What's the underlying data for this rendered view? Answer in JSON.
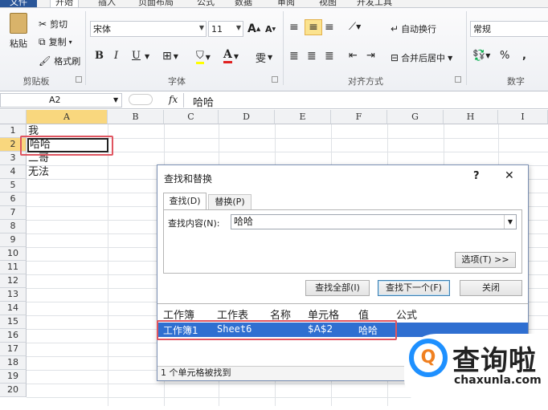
{
  "tabs": {
    "file": "文件",
    "home": "开始",
    "insert": "插入",
    "layout": "页面布局",
    "formulas": "公式",
    "data": "数据",
    "review": "审阅",
    "view": "视图",
    "dev": "开发工具"
  },
  "clipboard": {
    "paste": "粘贴",
    "cut": "剪切",
    "copy": "复制",
    "format_painter": "格式刷",
    "label": "剪贴板"
  },
  "font": {
    "name": "宋体",
    "size": "11",
    "label": "字体",
    "bold": "B",
    "italic": "I",
    "underline": "U",
    "grow": "A",
    "shrink": "A",
    "color_letter": "A",
    "phonetic": "雯"
  },
  "alignment": {
    "wrap": "自动换行",
    "merge": "合并后居中",
    "label": "对齐方式"
  },
  "number": {
    "format": "常规",
    "label": "数字",
    "percent": "%",
    "comma": ","
  },
  "formula_bar": {
    "name_box": "A2",
    "fx": "fx",
    "value": "哈哈"
  },
  "columns": [
    "A",
    "B",
    "C",
    "D",
    "E",
    "F",
    "G",
    "H",
    "I"
  ],
  "rows": [
    "1",
    "2",
    "3",
    "4",
    "5",
    "6",
    "7",
    "8",
    "9",
    "10",
    "11",
    "12",
    "13",
    "14",
    "15",
    "16",
    "17",
    "18",
    "19",
    "20"
  ],
  "cells": {
    "A1": "我",
    "A2": "哈哈",
    "A3": "二哥",
    "A4": "无法"
  },
  "dialog": {
    "title": "查找和替换",
    "help": "?",
    "close": "✕",
    "tab_find": "查找(D)",
    "tab_replace": "替换(P)",
    "find_label": "查找内容(N):",
    "find_value": "哈哈",
    "options": "选项(T) >>",
    "find_all": "查找全部(I)",
    "find_next": "查找下一个(F)",
    "close_btn": "关闭",
    "results_headers": [
      "工作簿",
      "工作表",
      "名称",
      "单元格",
      "值",
      "公式"
    ],
    "result_row": {
      "workbook": "工作簿1",
      "sheet": "Sheet6",
      "name": "",
      "cell": "$A$2",
      "value": "哈哈",
      "formula": ""
    },
    "status": "1 个单元格被找到"
  },
  "watermark": {
    "brand": "查询啦",
    "url": "chaxunla.com",
    "logo_letter": "Q"
  },
  "colors": {
    "accent": "#2a5699",
    "selection": "#2f6fd1",
    "highlight": "#e05560",
    "logo": "#1e90ff"
  }
}
